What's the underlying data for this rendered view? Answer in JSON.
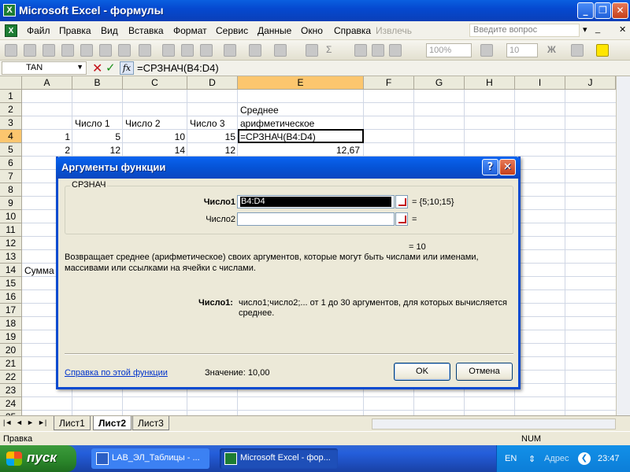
{
  "window": {
    "title": "Microsoft Excel - формулы",
    "buttons": [
      "_",
      "❐",
      "✕"
    ]
  },
  "menu": {
    "items": [
      "Файл",
      "Правка",
      "Вид",
      "Вставка",
      "Формат",
      "Сервис",
      "Данные",
      "Окно",
      "Справка",
      "Извлечь"
    ],
    "help_placeholder": "Введите вопрос",
    "doc_controls": [
      "▾",
      "_",
      "✕"
    ]
  },
  "toolbar": {
    "zoom": "100%",
    "font_size": "10",
    "bold": "Ж",
    "sigma": "Σ"
  },
  "formula_bar": {
    "name_box": "TAN",
    "cancel_icon": "✕",
    "enter_icon": "✓",
    "fx_label": "fx",
    "formula": "=СРЗНАЧ(B4:D4)"
  },
  "grid": {
    "columns": [
      "A",
      "B",
      "C",
      "D",
      "E",
      "F",
      "G",
      "H",
      "I",
      "J"
    ],
    "rows": [
      "1",
      "2",
      "3",
      "4",
      "5",
      "6",
      "7",
      "8",
      "9",
      "10",
      "11",
      "12",
      "13",
      "14",
      "15",
      "16",
      "17",
      "18",
      "19",
      "20",
      "21",
      "22",
      "23",
      "24",
      "25"
    ],
    "cells": {
      "E2": "Среднее",
      "B3": "Число 1",
      "C3": "Число 2",
      "D3": "Число 3",
      "E3": "арифметическое",
      "A4": "1",
      "B4": "5",
      "C4": "10",
      "D4": "15",
      "E4": "=СРЗНАЧ(B4:D4)",
      "A5": "2",
      "B5": "12",
      "C5": "14",
      "D5": "12",
      "E5": "12,67",
      "A14": "Сумма"
    }
  },
  "sheets": {
    "nav": [
      "|◄",
      "◄",
      "►",
      "►|"
    ],
    "tabs": [
      "Лист1",
      "Лист2",
      "Лист3"
    ],
    "active": "Лист2"
  },
  "status": {
    "left": "Правка",
    "num": "NUM"
  },
  "dialog": {
    "title": "Аргументы функции",
    "function_name": "СРЗНАЧ",
    "args": [
      {
        "label": "Число1",
        "value": "B4:D4",
        "result": "= {5;10;15}"
      },
      {
        "label": "Число2",
        "value": "",
        "result": "="
      }
    ],
    "result": "= 10",
    "description": "Возвращает среднее (арифметическое) своих аргументов, которые могут быть числами или именами, массивами или ссылками на ячейки с числами.",
    "arg_help_label": "Число1:",
    "arg_help_text": "число1;число2;... от 1 до 30 аргументов, для которых вычисляется среднее.",
    "help_link": "Справка по этой функции",
    "value_label": "Значение:",
    "value": "10,00",
    "ok": "OK",
    "cancel": "Отмена"
  },
  "taskbar": {
    "start": "пуск",
    "tasks": [
      {
        "label": "LAB_ЭЛ_Таблицы - ...",
        "active": false
      },
      {
        "label": "Microsoft Excel - фор...",
        "active": true
      }
    ],
    "lang": "EN",
    "address_label": "Адрес",
    "time": "23:47"
  }
}
